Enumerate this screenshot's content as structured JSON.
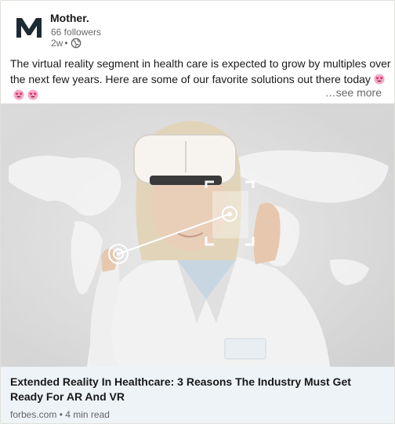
{
  "post": {
    "company_name": "Mother.",
    "logo_letter": "M",
    "followers": "66 followers",
    "age": "2w",
    "age_separator": "•",
    "visibility_icon": "globe-icon",
    "text": "The virtual reality segment in health care is expected to grow by multiples over the next few years. Here are some of our favorite solutions out there today",
    "emojis": [
      "heart-eyes-emoji",
      "heart-eyes-emoji",
      "heart-eyes-emoji"
    ],
    "see_more": "…see more"
  },
  "article": {
    "image_description_icon": "vr-doctor-image",
    "title": "Extended Reality In Healthcare: 3 Reasons The Industry Must Get Ready For AR And VR",
    "source": "forbes.com • 4 min read"
  },
  "colors": {
    "footer_bg": "#eef3f8",
    "text_primary": "rgba(0,0,0,0.9)",
    "text_secondary": "rgba(0,0,0,0.6)",
    "emoji_face": "#f7a8c9",
    "emoji_eyes": "#e0245e"
  }
}
